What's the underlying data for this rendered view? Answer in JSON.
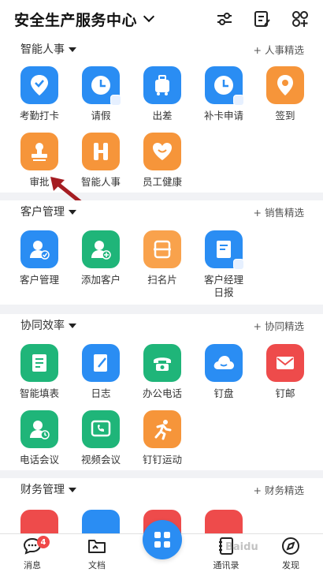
{
  "header": {
    "org_title": "安全生产服务中心",
    "icons": [
      "settings-sliders-icon",
      "edit-list-icon",
      "add-app-icon"
    ]
  },
  "sections": {
    "hr": {
      "title": "智能人事",
      "link": "+ 人事精选",
      "items": [
        {
          "label": "考勤打卡",
          "icon": "check-location-icon",
          "color": "#2a8df3"
        },
        {
          "label": "请假",
          "icon": "clock-icon",
          "color": "#2a8df3"
        },
        {
          "label": "出差",
          "icon": "suitcase-icon",
          "color": "#2a8df3"
        },
        {
          "label": "补卡申请",
          "icon": "clock-icon",
          "color": "#2a8df3"
        },
        {
          "label": "签到",
          "icon": "location-pin-icon",
          "color": "#f6953a"
        },
        {
          "label": "审批",
          "icon": "stamp-icon",
          "color": "#f6953a"
        },
        {
          "label": "智能人事",
          "icon": "h-logo-icon",
          "color": "#f6953a"
        },
        {
          "label": "员工健康",
          "icon": "heart-icon",
          "color": "#f6953a"
        }
      ]
    },
    "crm": {
      "title": "客户管理",
      "link": "+ 销售精选",
      "items": [
        {
          "label": "客户管理",
          "icon": "customer-check-icon",
          "color": "#2a8df3"
        },
        {
          "label": "添加客户",
          "icon": "add-customer-icon",
          "color": "#1fb579"
        },
        {
          "label": "扫名片",
          "icon": "scan-card-icon",
          "color": "#f9a24c"
        },
        {
          "label": "客户经理日报",
          "icon": "daily-report-icon",
          "color": "#2a8df3"
        }
      ]
    },
    "collab": {
      "title": "协同效率",
      "link": "+ 协同精选",
      "items": [
        {
          "label": "智能填表",
          "icon": "form-icon",
          "color": "#1fb579"
        },
        {
          "label": "日志",
          "icon": "log-icon",
          "color": "#2a8df3"
        },
        {
          "label": "办公电话",
          "icon": "phone-icon",
          "color": "#1fb579"
        },
        {
          "label": "钉盘",
          "icon": "cloud-icon",
          "color": "#2a8df3"
        },
        {
          "label": "钉邮",
          "icon": "mail-icon",
          "color": "#ee4b4b"
        },
        {
          "label": "电话会议",
          "icon": "conference-call-icon",
          "color": "#1fb579"
        },
        {
          "label": "视频会议",
          "icon": "video-call-icon",
          "color": "#1fb579"
        },
        {
          "label": "钉钉运动",
          "icon": "running-icon",
          "color": "#f6953a"
        }
      ]
    },
    "finance": {
      "title": "财务管理",
      "link": "+ 财务精选",
      "items": [
        {
          "label": "",
          "icon": "money-bag-icon",
          "color": "#ee4b4b"
        },
        {
          "label": "",
          "icon": "brush-icon",
          "color": "#2a8df3"
        },
        {
          "label": "",
          "icon": "money-down-icon",
          "color": "#ee4b4b"
        },
        {
          "label": "",
          "icon": "money-bag-icon",
          "color": "#ee4b4b"
        }
      ]
    }
  },
  "tabbar": {
    "messages": {
      "label": "消息",
      "badge": "4"
    },
    "docs": {
      "label": "文档"
    },
    "workbench": {
      "icon": "workbench-grid-icon"
    },
    "contacts": {
      "label": "通讯录"
    },
    "discover": {
      "label": "发现"
    }
  },
  "watermark": "Baidu"
}
